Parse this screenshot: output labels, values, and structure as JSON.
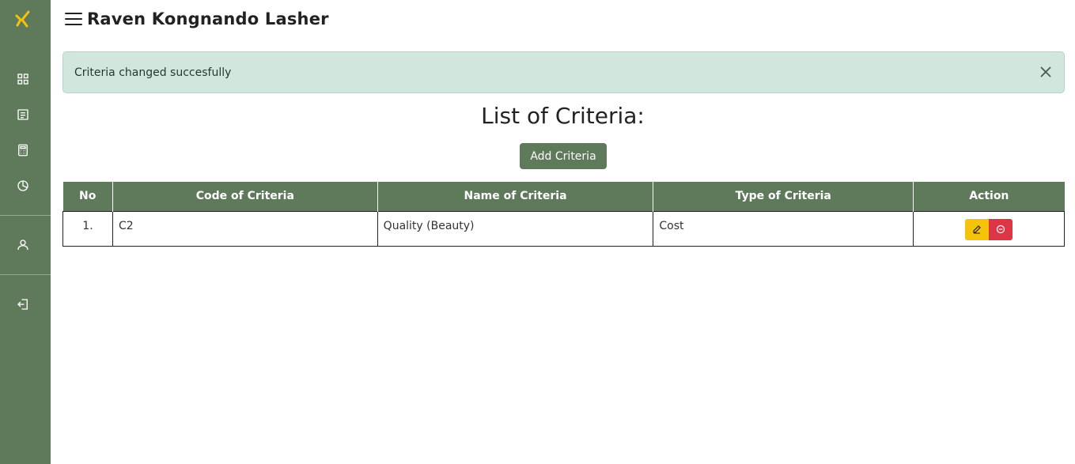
{
  "header": {
    "title": "Raven Kongnando Lasher"
  },
  "sidebar": {
    "items": [
      {
        "icon": "grid-icon"
      },
      {
        "icon": "document-icon"
      },
      {
        "icon": "calculator-icon"
      },
      {
        "icon": "pie-chart-icon"
      },
      {
        "icon": "user-icon"
      },
      {
        "icon": "logout-icon"
      }
    ]
  },
  "alert": {
    "message": "Criteria changed succesfully"
  },
  "main": {
    "title": "List of Criteria:",
    "add_button": "Add Criteria",
    "table": {
      "columns": [
        "No",
        "Code of Criteria",
        "Name of Criteria",
        "Type of Criteria",
        "Action"
      ],
      "rows": [
        {
          "no": "1.",
          "code": "C2",
          "name": "Quality (Beauty)",
          "type": "Cost"
        }
      ]
    }
  },
  "colors": {
    "brand": "#5e7a5b",
    "edit": "#f5c40a",
    "delete": "#dc3545",
    "alert_bg": "#d1e7dd"
  }
}
